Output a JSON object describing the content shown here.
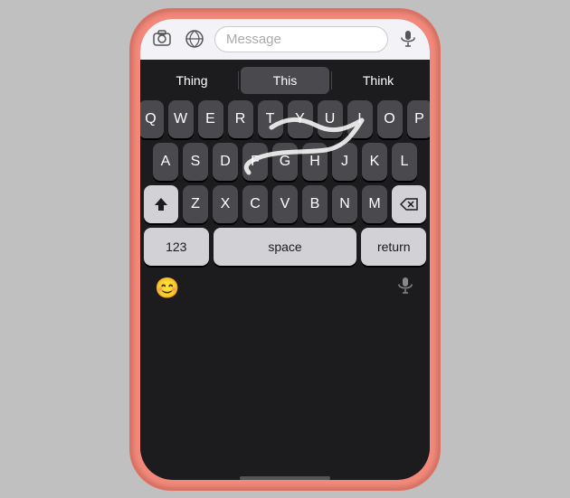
{
  "phone": {
    "status": "Message",
    "top_icons": {
      "camera": "⊙",
      "apps": "⊕",
      "mic": "🎙"
    },
    "message_placeholder": "Message"
  },
  "predictive": {
    "items": [
      "Thing",
      "This",
      "Think"
    ],
    "active_index": 1
  },
  "keyboard": {
    "rows": [
      [
        "Q",
        "W",
        "E",
        "R",
        "T",
        "Y",
        "U",
        "I",
        "O",
        "P"
      ],
      [
        "A",
        "S",
        "D",
        "F",
        "G",
        "H",
        "J",
        "K",
        "L"
      ],
      [
        "Z",
        "X",
        "C",
        "V",
        "B",
        "N",
        "M"
      ]
    ],
    "bottom_keys": {
      "numbers": "123",
      "space": "space",
      "return": "return"
    }
  },
  "bottom_bar": {
    "emoji_icon": "😊",
    "mic_icon": "🎙"
  }
}
